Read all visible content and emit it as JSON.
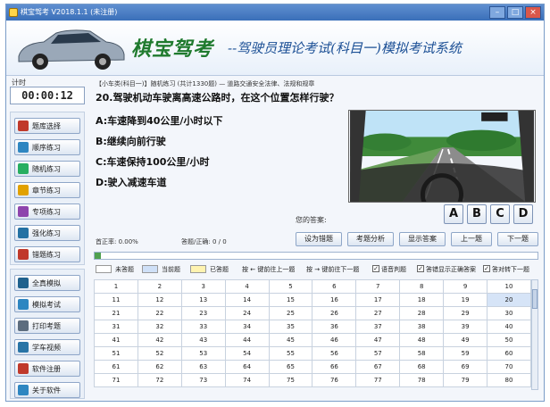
{
  "window": {
    "title": "棋宝驾考 V2018.1.1 (未注册)"
  },
  "banner": {
    "title": "棋宝驾考",
    "subtitle": "--驾驶员理论考试(科目一)模拟考试系统"
  },
  "timer": {
    "label": "计时",
    "value": "00:00:12"
  },
  "nav": {
    "group1": [
      {
        "label": "题库选择",
        "color": "#c0392b"
      },
      {
        "label": "顺序练习",
        "color": "#2e86c1"
      },
      {
        "label": "随机练习",
        "color": "#27ae60"
      },
      {
        "label": "章节练习",
        "color": "#e1a100"
      },
      {
        "label": "专项练习",
        "color": "#8e44ad"
      },
      {
        "label": "强化练习",
        "color": "#2471a3"
      },
      {
        "label": "错题练习",
        "color": "#c0392b"
      }
    ],
    "group2": [
      {
        "label": "全真模拟",
        "color": "#1f618d"
      },
      {
        "label": "模拟考试",
        "color": "#2e86c1"
      },
      {
        "label": "打印考题",
        "color": "#5d6d7e"
      },
      {
        "label": "学车视频",
        "color": "#2874a6"
      },
      {
        "label": "软件注册",
        "color": "#c0392b"
      },
      {
        "label": "关于软件",
        "color": "#2e86c1"
      }
    ]
  },
  "breadcrumb": "【小车类(科目一)】随机练习 (共计1330题) — 道路交通安全法律、法规和规章",
  "question": {
    "text": "20.驾驶机动车驶离高速公路时，在这个位置怎样行驶？",
    "options": [
      "A:车速降到40公里/小时以下",
      "B:继续向前行驶",
      "C:车速保持100公里/小时",
      "D:驶入减速车道"
    ]
  },
  "answer": {
    "label": "您的答案:",
    "choices": [
      "A",
      "B",
      "C",
      "D"
    ]
  },
  "stats": {
    "accuracy": "首正率: 0.00%",
    "answered": "答题/正确: 0 / 0"
  },
  "actions": [
    "设为错题",
    "考题分析",
    "显示答案",
    "上一题",
    "下一题"
  ],
  "progress": {
    "fraction": 0.015
  },
  "legend": {
    "unanswered": "未答题",
    "current": "当前题",
    "answered": "已答题",
    "key_prev": "按 ← 键前往上一题",
    "key_next": "按 → 键前往下一题",
    "voice": "语音判题",
    "show_correct": "答错显示正确答案",
    "auto_next": "答对转下一题",
    "colors": {
      "unanswered": "#ffffff",
      "current": "#cfe0f7",
      "answered": "#fff3b0"
    }
  },
  "grid": {
    "rows": [
      [
        1,
        2,
        3,
        4,
        5,
        6,
        7,
        8,
        9,
        10
      ],
      [
        11,
        12,
        13,
        14,
        15,
        16,
        17,
        18,
        19,
        20
      ],
      [
        21,
        22,
        23,
        24,
        25,
        26,
        27,
        28,
        29,
        30
      ],
      [
        31,
        32,
        33,
        34,
        35,
        36,
        37,
        38,
        39,
        40
      ],
      [
        41,
        42,
        43,
        44,
        45,
        46,
        47,
        48,
        49,
        50
      ],
      [
        51,
        52,
        53,
        54,
        55,
        56,
        57,
        58,
        59,
        60
      ],
      [
        61,
        62,
        63,
        64,
        65,
        66,
        67,
        68,
        69,
        70
      ],
      [
        71,
        72,
        73,
        74,
        75,
        76,
        77,
        78,
        79,
        80
      ]
    ],
    "current": 20
  }
}
